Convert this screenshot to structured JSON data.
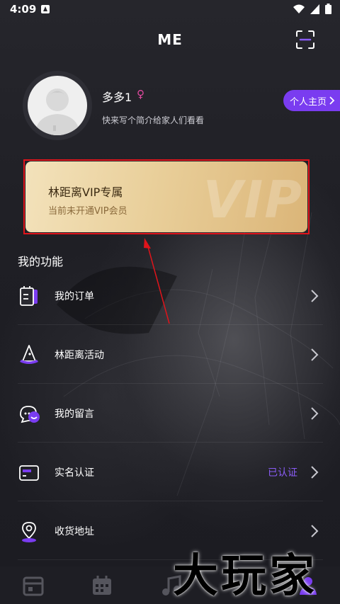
{
  "status_bar": {
    "time": "4:09",
    "icons": [
      "app-notification-icon",
      "wifi-icon",
      "signal-icon",
      "battery-icon"
    ]
  },
  "header": {
    "title": "ME",
    "scan_icon": "scan-icon"
  },
  "profile": {
    "name": "多多1",
    "gender_symbol": "♀",
    "bio": "快来写个简介给家人们看看",
    "homepage_button": "个人主页"
  },
  "vip_card": {
    "title": "林距离VIP专属",
    "subtitle": "当前未开通VIP会员",
    "background_text": "VIP"
  },
  "functions": {
    "section_title": "我的功能",
    "items": [
      {
        "label": "我的订单",
        "icon": "order-icon"
      },
      {
        "label": "林距离活动",
        "icon": "wizard-hat-icon"
      },
      {
        "label": "我的留言",
        "icon": "message-icon"
      },
      {
        "label": "实名认证",
        "icon": "id-card-icon",
        "status": "已认证"
      },
      {
        "label": "收货地址",
        "icon": "location-icon"
      }
    ]
  },
  "bottom_nav": {
    "items": [
      "home-icon",
      "calendar-icon",
      "music-icon",
      "profile-icon"
    ],
    "active_index": 3
  },
  "watermark": {
    "text": "大玩家"
  },
  "colors": {
    "accent": "#7a3cf0",
    "verified": "#8a5cf6",
    "vip_gold": "#e9cf9a",
    "highlight_red": "#e0141b",
    "background": "#1c1c22"
  }
}
